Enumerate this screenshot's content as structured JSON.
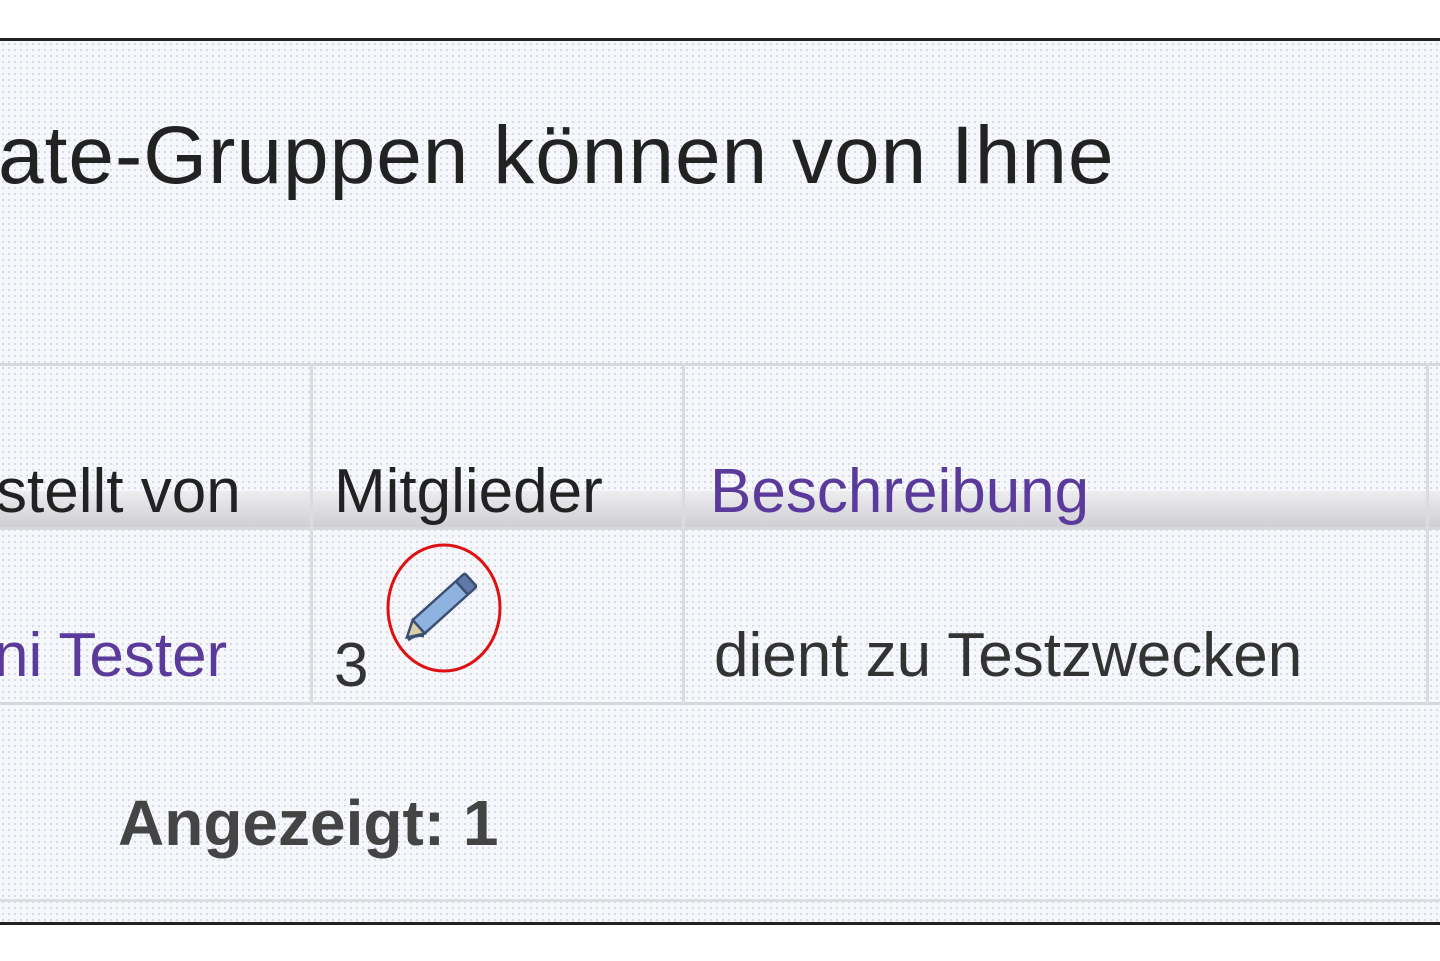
{
  "intro_text": "ate-Gruppen können von Ihne",
  "table": {
    "headers": {
      "created_by": "stellt von",
      "members": "Mitglieder",
      "description": "Beschreibung"
    },
    "rows": [
      {
        "created_by": "ni Tester",
        "members": "3",
        "description": "dient zu Testzwecken"
      }
    ]
  },
  "footer": {
    "shown": "Angezeigt: 1"
  },
  "icons": {
    "edit": "pencil-icon"
  },
  "colors": {
    "link": "#5a3a9a",
    "highlight_circle": "#e01010"
  }
}
